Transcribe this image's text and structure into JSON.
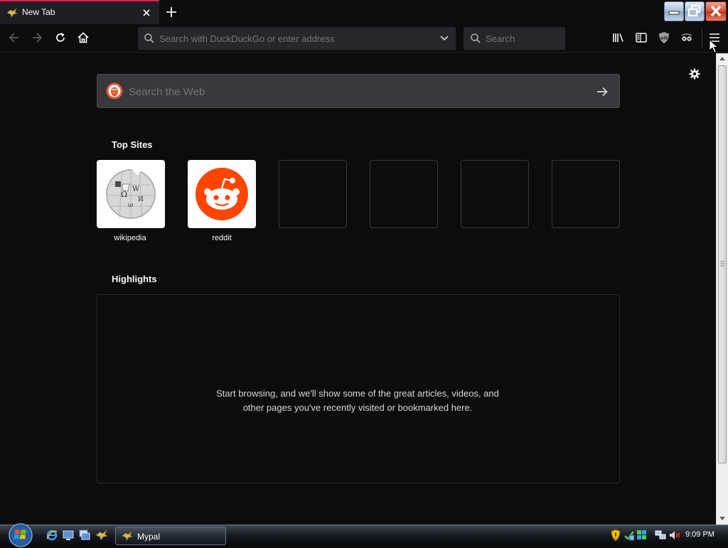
{
  "browser": {
    "tab": {
      "title": "New Tab"
    },
    "urlbar": {
      "placeholder": "Search with DuckDuckGo or enter address"
    },
    "searchbar": {
      "placeholder": "Search"
    }
  },
  "newtab": {
    "websearch": {
      "placeholder": "Search the Web"
    },
    "top_sites_title": "Top Sites",
    "top_sites": [
      {
        "label": "wikipedia"
      },
      {
        "label": "reddit"
      },
      {
        "label": ""
      },
      {
        "label": ""
      },
      {
        "label": ""
      },
      {
        "label": ""
      }
    ],
    "highlights_title": "Highlights",
    "highlights_message": "Start browsing, and we'll show some of the great articles, videos, and other pages you've recently visited or bookmarked here."
  },
  "taskbar": {
    "task_label": "Mypal",
    "clock": "9:09 PM"
  },
  "colors": {
    "accent": "#e31d3b",
    "page_bg": "#0c0c0d",
    "reddit": "#ff4500"
  }
}
